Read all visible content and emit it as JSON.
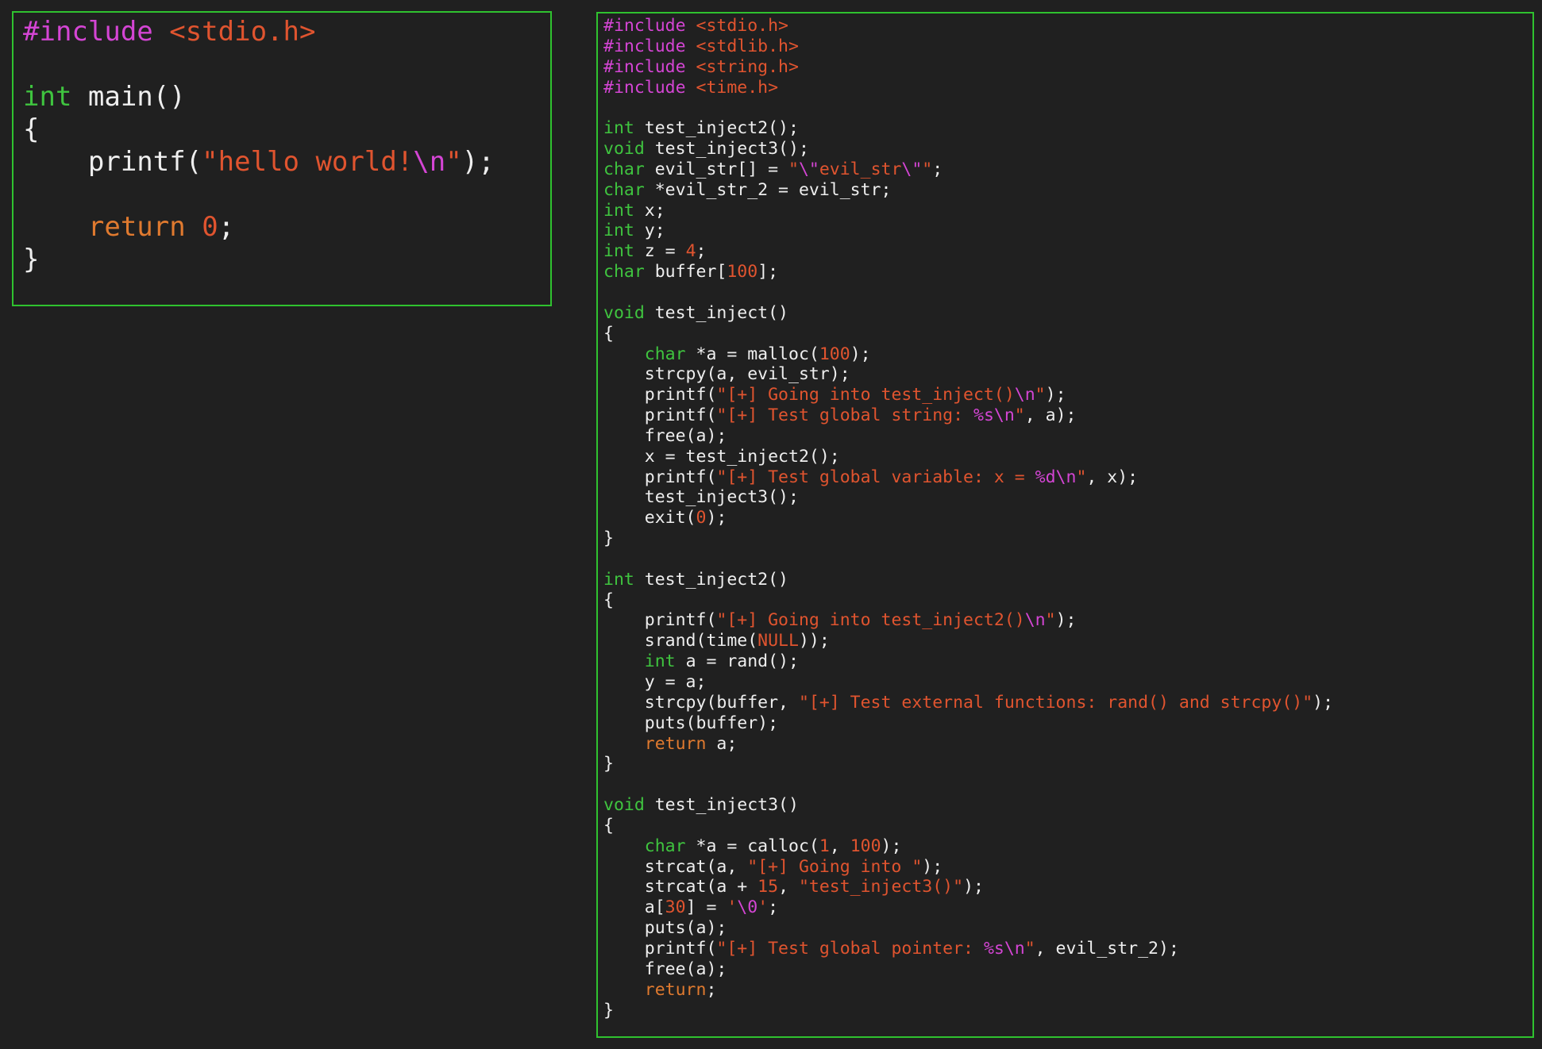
{
  "left_panel": {
    "lines": [
      [
        [
          "pp",
          "#include "
        ],
        [
          "hdr",
          "<stdio.h>"
        ]
      ],
      [],
      [
        [
          "kw",
          "int"
        ],
        [
          "txt",
          " main()"
        ]
      ],
      [
        [
          "txt",
          "{"
        ]
      ],
      [
        [
          "txt",
          "    printf("
        ],
        [
          "str",
          "\"hello world!"
        ],
        [
          "esc",
          "\\n"
        ],
        [
          "str",
          "\""
        ],
        [
          "txt",
          ");"
        ]
      ],
      [],
      [
        [
          "txt",
          "    "
        ],
        [
          "ret",
          "return"
        ],
        [
          "txt",
          " "
        ],
        [
          "num",
          "0"
        ],
        [
          "txt",
          ";"
        ]
      ],
      [
        [
          "txt",
          "}"
        ]
      ]
    ]
  },
  "right_panel": {
    "lines": [
      [
        [
          "pp",
          "#include "
        ],
        [
          "hdr",
          "<stdio.h>"
        ]
      ],
      [
        [
          "pp",
          "#include "
        ],
        [
          "hdr",
          "<stdlib.h>"
        ]
      ],
      [
        [
          "pp",
          "#include "
        ],
        [
          "hdr",
          "<string.h>"
        ]
      ],
      [
        [
          "pp",
          "#include "
        ],
        [
          "hdr",
          "<time.h>"
        ]
      ],
      [],
      [
        [
          "kw",
          "int"
        ],
        [
          "txt",
          " test_inject2();"
        ]
      ],
      [
        [
          "kw",
          "void"
        ],
        [
          "txt",
          " test_inject3();"
        ]
      ],
      [
        [
          "kw",
          "char"
        ],
        [
          "txt",
          " evil_str[] = "
        ],
        [
          "str",
          "\""
        ],
        [
          "esc",
          "\\\""
        ],
        [
          "str",
          "evil_str"
        ],
        [
          "esc",
          "\\\""
        ],
        [
          "str",
          "\""
        ],
        [
          "txt",
          ";"
        ]
      ],
      [
        [
          "kw",
          "char"
        ],
        [
          "txt",
          " *evil_str_2 = evil_str;"
        ]
      ],
      [
        [
          "kw",
          "int"
        ],
        [
          "txt",
          " x;"
        ]
      ],
      [
        [
          "kw",
          "int"
        ],
        [
          "txt",
          " y;"
        ]
      ],
      [
        [
          "kw",
          "int"
        ],
        [
          "txt",
          " z = "
        ],
        [
          "num",
          "4"
        ],
        [
          "txt",
          ";"
        ]
      ],
      [
        [
          "kw",
          "char"
        ],
        [
          "txt",
          " buffer["
        ],
        [
          "num",
          "100"
        ],
        [
          "txt",
          "];"
        ]
      ],
      [],
      [
        [
          "kw",
          "void"
        ],
        [
          "txt",
          " test_inject()"
        ]
      ],
      [
        [
          "txt",
          "{"
        ]
      ],
      [
        [
          "txt",
          "    "
        ],
        [
          "kw",
          "char"
        ],
        [
          "txt",
          " *a = malloc("
        ],
        [
          "num",
          "100"
        ],
        [
          "txt",
          ");"
        ]
      ],
      [
        [
          "txt",
          "    strcpy(a, evil_str);"
        ]
      ],
      [
        [
          "txt",
          "    printf("
        ],
        [
          "str",
          "\"[+] Going into test_inject()"
        ],
        [
          "esc",
          "\\n"
        ],
        [
          "str",
          "\""
        ],
        [
          "txt",
          ");"
        ]
      ],
      [
        [
          "txt",
          "    printf("
        ],
        [
          "str",
          "\"[+] Test global string: "
        ],
        [
          "esc",
          "%s\\n"
        ],
        [
          "str",
          "\""
        ],
        [
          "txt",
          ", a);"
        ]
      ],
      [
        [
          "txt",
          "    free(a);"
        ]
      ],
      [
        [
          "txt",
          "    x = test_inject2();"
        ]
      ],
      [
        [
          "txt",
          "    printf("
        ],
        [
          "str",
          "\"[+] Test global variable: x = "
        ],
        [
          "esc",
          "%d\\n"
        ],
        [
          "str",
          "\""
        ],
        [
          "txt",
          ", x);"
        ]
      ],
      [
        [
          "txt",
          "    test_inject3();"
        ]
      ],
      [
        [
          "txt",
          "    exit("
        ],
        [
          "num",
          "0"
        ],
        [
          "txt",
          ");"
        ]
      ],
      [
        [
          "txt",
          "}"
        ]
      ],
      [],
      [
        [
          "kw",
          "int"
        ],
        [
          "txt",
          " test_inject2()"
        ]
      ],
      [
        [
          "txt",
          "{"
        ]
      ],
      [
        [
          "txt",
          "    printf("
        ],
        [
          "str",
          "\"[+] Going into test_inject2()"
        ],
        [
          "esc",
          "\\n"
        ],
        [
          "str",
          "\""
        ],
        [
          "txt",
          ");"
        ]
      ],
      [
        [
          "txt",
          "    srand(time("
        ],
        [
          "num",
          "NULL"
        ],
        [
          "txt",
          "));"
        ]
      ],
      [
        [
          "txt",
          "    "
        ],
        [
          "kw",
          "int"
        ],
        [
          "txt",
          " a = rand();"
        ]
      ],
      [
        [
          "txt",
          "    y = a;"
        ]
      ],
      [
        [
          "txt",
          "    strcpy(buffer, "
        ],
        [
          "str",
          "\"[+] Test external functions: rand() and strcpy()\""
        ],
        [
          "txt",
          ");"
        ]
      ],
      [
        [
          "txt",
          "    puts(buffer);"
        ]
      ],
      [
        [
          "txt",
          "    "
        ],
        [
          "ret",
          "return"
        ],
        [
          "txt",
          " a;"
        ]
      ],
      [
        [
          "txt",
          "}"
        ]
      ],
      [],
      [
        [
          "kw",
          "void"
        ],
        [
          "txt",
          " test_inject3()"
        ]
      ],
      [
        [
          "txt",
          "{"
        ]
      ],
      [
        [
          "txt",
          "    "
        ],
        [
          "kw",
          "char"
        ],
        [
          "txt",
          " *a = calloc("
        ],
        [
          "num",
          "1"
        ],
        [
          "txt",
          ", "
        ],
        [
          "num",
          "100"
        ],
        [
          "txt",
          ");"
        ]
      ],
      [
        [
          "txt",
          "    strcat(a, "
        ],
        [
          "str",
          "\"[+] Going into \""
        ],
        [
          "txt",
          ");"
        ]
      ],
      [
        [
          "txt",
          "    strcat(a + "
        ],
        [
          "num",
          "15"
        ],
        [
          "txt",
          ", "
        ],
        [
          "str",
          "\"test_inject3()\""
        ],
        [
          "txt",
          ");"
        ]
      ],
      [
        [
          "txt",
          "    a["
        ],
        [
          "num",
          "30"
        ],
        [
          "txt",
          "] = "
        ],
        [
          "str",
          "'"
        ],
        [
          "esc",
          "\\0"
        ],
        [
          "str",
          "'"
        ],
        [
          "txt",
          ";"
        ]
      ],
      [
        [
          "txt",
          "    puts(a);"
        ]
      ],
      [
        [
          "txt",
          "    printf("
        ],
        [
          "str",
          "\"[+] Test global pointer: "
        ],
        [
          "esc",
          "%s\\n"
        ],
        [
          "str",
          "\""
        ],
        [
          "txt",
          ", evil_str_2);"
        ]
      ],
      [
        [
          "txt",
          "    free(a);"
        ]
      ],
      [
        [
          "txt",
          "    "
        ],
        [
          "ret",
          "return"
        ],
        [
          "txt",
          ";"
        ]
      ],
      [
        [
          "txt",
          "}"
        ]
      ]
    ]
  },
  "colors": {
    "background": "#202020",
    "panel_border": "#2fc22f",
    "text": "#eeeeee",
    "keyword": "#3fc43f",
    "preprocessor": "#d445d4",
    "string": "#e0542f",
    "number": "#e0542f",
    "escape": "#d445d4",
    "return_keyword": "#e07a2f"
  }
}
